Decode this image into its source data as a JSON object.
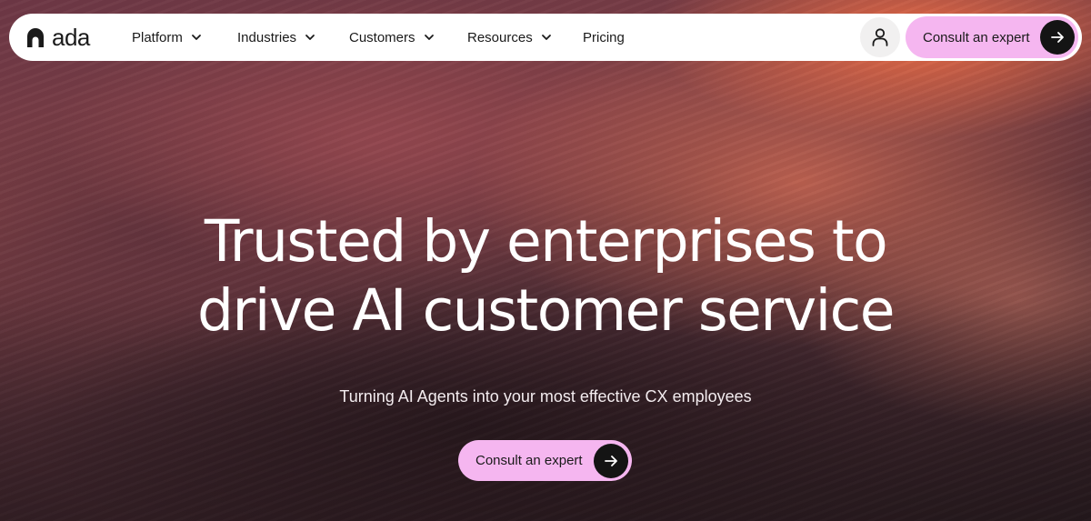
{
  "brand": {
    "name": "ada",
    "logo_icon": "ada-logo-icon"
  },
  "nav": {
    "items": [
      {
        "label": "Platform",
        "has_dropdown": true
      },
      {
        "label": "Industries",
        "has_dropdown": true
      },
      {
        "label": "Customers",
        "has_dropdown": true
      },
      {
        "label": "Resources",
        "has_dropdown": true
      },
      {
        "label": "Pricing",
        "has_dropdown": false
      }
    ],
    "user_icon": "user-icon",
    "cta_label": "Consult an expert",
    "cta_icon": "arrow-right-icon"
  },
  "hero": {
    "headline_line1": "Trusted by enterprises to",
    "headline_line2": "drive AI customer service",
    "subheadline": "Turning AI Agents into your most effective CX employees",
    "cta_label": "Consult an expert",
    "cta_icon": "arrow-right-icon"
  },
  "colors": {
    "cta_background": "#f5b6f0",
    "arrow_circle": "#141414",
    "navbar_background": "#ffffff",
    "text_dark": "#1a1a1a",
    "hero_text": "#ffffff"
  }
}
